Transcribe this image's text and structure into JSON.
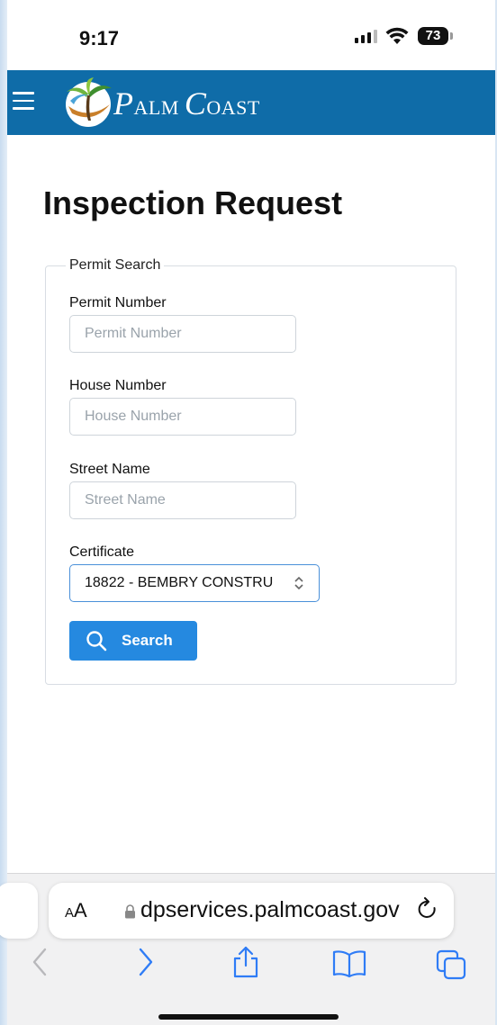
{
  "status_bar": {
    "time": "9:17",
    "battery": "73"
  },
  "header": {
    "logo_p": "P",
    "logo_alm": "ALM",
    "logo_c": "C",
    "logo_oast": "OAST",
    "menu_icon": "hamburger-icon"
  },
  "page": {
    "title": "Inspection Request"
  },
  "permit_search": {
    "legend": "Permit Search",
    "permit_number": {
      "label": "Permit Number",
      "placeholder": "Permit Number",
      "value": ""
    },
    "house_number": {
      "label": "House Number",
      "placeholder": "House Number",
      "value": ""
    },
    "street_name": {
      "label": "Street Name",
      "placeholder": "Street Name",
      "value": ""
    },
    "certificate": {
      "label": "Certificate",
      "selected": "18822 - BEMBRY CONSTRU"
    },
    "search_button": "Search"
  },
  "browser": {
    "aa_label_small": "A",
    "aa_label_big": "A",
    "url": "dpservices.palmcoast.gov",
    "accent_color": "#2f7cf6"
  },
  "colors": {
    "header_bg": "#0f6ca8",
    "button_bg": "#2589e0",
    "select_border": "#4a90d9"
  }
}
